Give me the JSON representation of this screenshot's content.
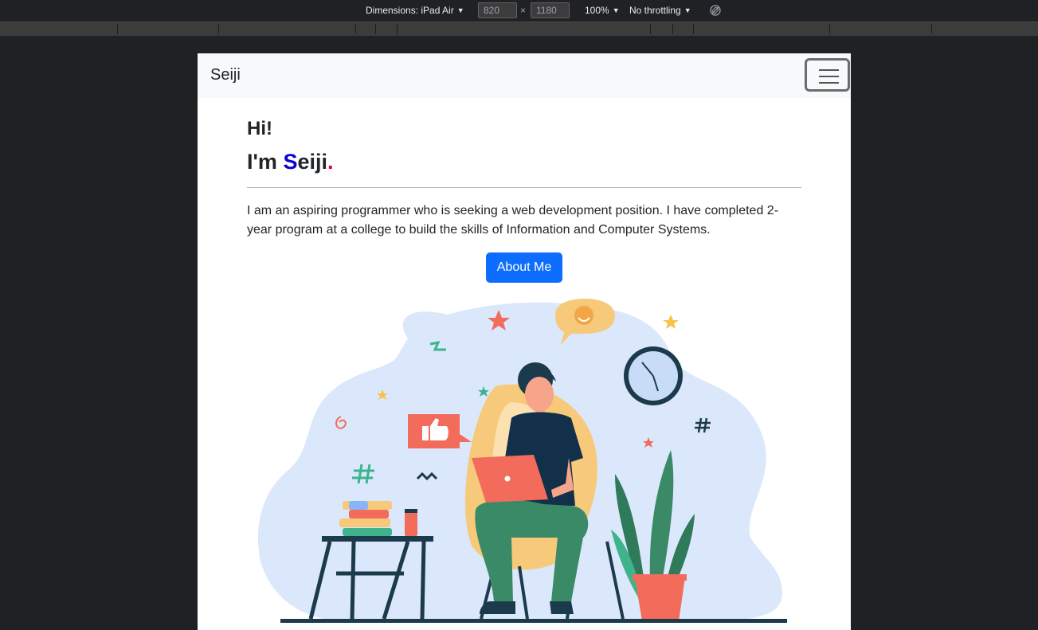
{
  "devtools": {
    "dimensions_label": "Dimensions: iPad Air",
    "width_value": "820",
    "height_value": "1180",
    "times_symbol": "×",
    "zoom": "100%",
    "throttling": "No throttling"
  },
  "navbar": {
    "brand": "Seiji"
  },
  "hero": {
    "greeting": "Hi!",
    "im_prefix": "I'm ",
    "name_first_letter": "S",
    "name_rest": "eiji",
    "name_dot": ".",
    "intro": "I am an aspiring programmer who is seeking a web development position. I have completed 2-year program at a college to build the skills of Information and Computer Systems.",
    "about_button": "About Me"
  },
  "colors": {
    "primary": "#0d6efd",
    "name_accent": "#0d00d6",
    "dot_accent": "#e0002a",
    "navbar_bg": "#f8f9fa"
  }
}
